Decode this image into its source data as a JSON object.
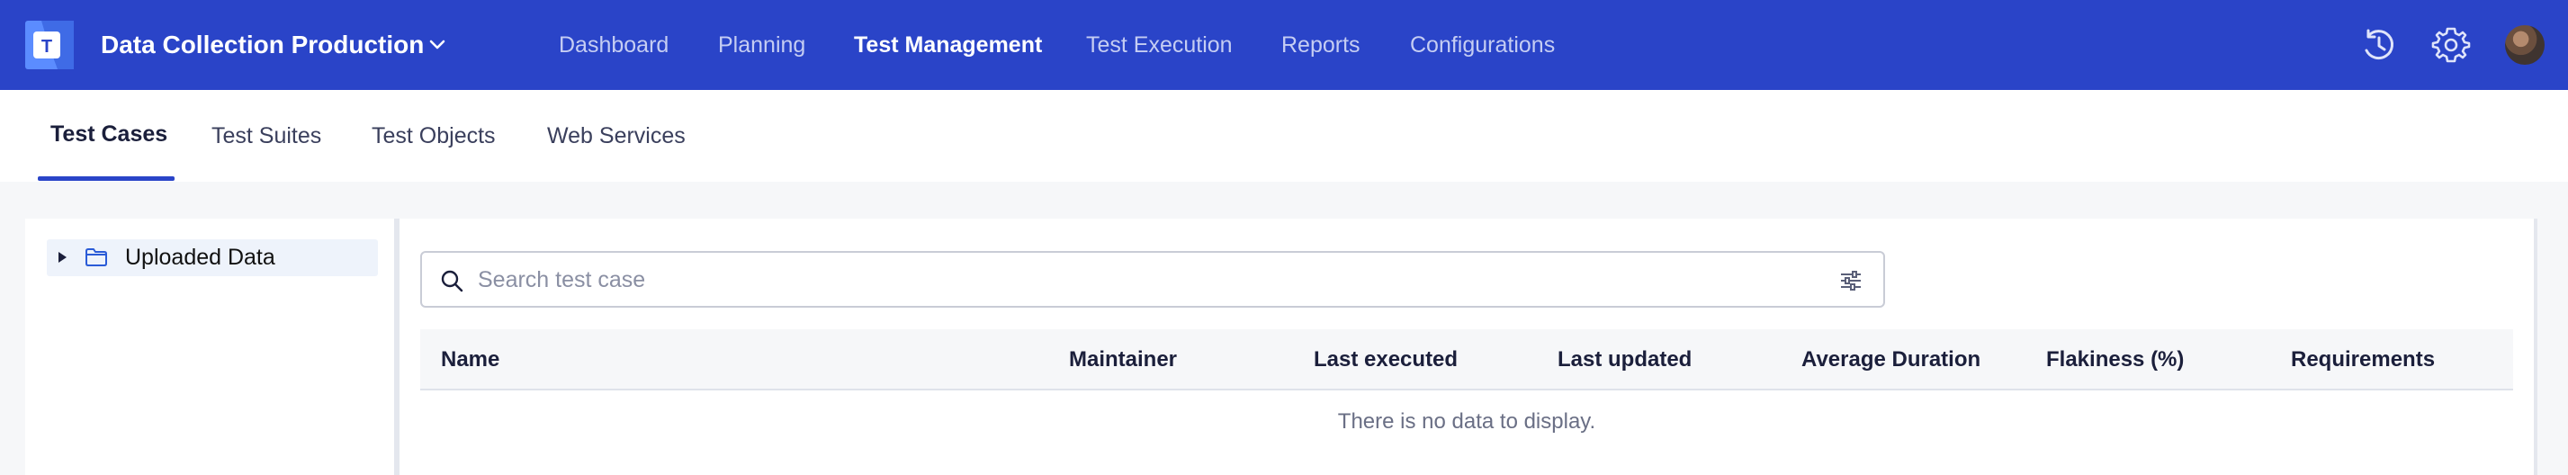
{
  "header": {
    "project_name": "Data Collection Production",
    "nav": [
      {
        "label": "Dashboard",
        "active": false
      },
      {
        "label": "Planning",
        "active": false
      },
      {
        "label": "Test Management",
        "active": true
      },
      {
        "label": "Test Execution",
        "active": false
      },
      {
        "label": "Reports",
        "active": false
      },
      {
        "label": "Configurations",
        "active": false
      }
    ],
    "icons": [
      "history-icon",
      "gear-icon",
      "avatar"
    ],
    "colors": {
      "bar": "#2a44c8",
      "active_text": "#ffffff",
      "inactive_text": "#c5cdf3"
    }
  },
  "subnav": {
    "tabs": [
      {
        "label": "Test Cases",
        "active": true
      },
      {
        "label": "Test Suites",
        "active": false
      },
      {
        "label": "Test Objects",
        "active": false
      },
      {
        "label": "Web Services",
        "active": false
      }
    ]
  },
  "tree": {
    "items": [
      {
        "label": "Uploaded Data",
        "icon": "folder-icon",
        "expanded": false
      }
    ]
  },
  "search": {
    "placeholder": "Search test case",
    "value": ""
  },
  "table": {
    "columns": [
      "Name",
      "Maintainer",
      "Last executed",
      "Last updated",
      "Average Duration",
      "Flakiness (%)",
      "Requirements"
    ],
    "rows": [],
    "empty_message": "There is no data to display."
  }
}
